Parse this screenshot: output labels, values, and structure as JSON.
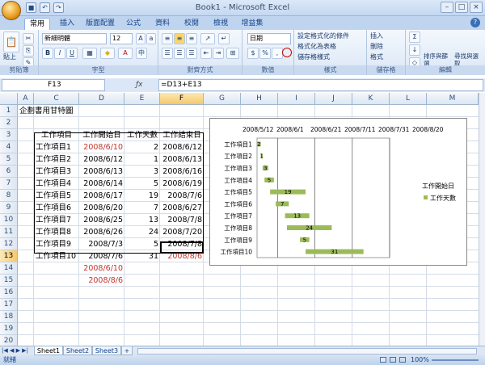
{
  "app": {
    "title": "Book1 - Microsoft Excel",
    "qat": [
      "save",
      "undo",
      "redo"
    ],
    "window_buttons": [
      "–",
      "□",
      "×"
    ]
  },
  "tabs": [
    "常用",
    "插入",
    "版面配置",
    "公式",
    "資料",
    "校閱",
    "檢視",
    "增益集"
  ],
  "active_tab": "常用",
  "ribbon": {
    "paste_label": "貼上",
    "font_name": "新細明體",
    "font_size": "12",
    "number_format": "日期",
    "styles": [
      "設定格式化的條件",
      "格式化為表格",
      "儲存格樣式"
    ],
    "cells": [
      "插入",
      "刪除",
      "格式"
    ],
    "editing": [
      "排序與篩選",
      "尋找與選取"
    ],
    "groups": [
      "剪貼簿",
      "字型",
      "對齊方式",
      "數值",
      "樣式",
      "儲存格",
      "編輯"
    ]
  },
  "formula_bar": {
    "name_box": "F13",
    "formula": "=D13+E13"
  },
  "columns": [
    "A",
    "C",
    "D",
    "E",
    "F",
    "G",
    "H",
    "I",
    "J",
    "K",
    "L",
    "M"
  ],
  "rows": [
    "1",
    "2",
    "3",
    "4",
    "5",
    "6",
    "7",
    "8",
    "9",
    "10",
    "11",
    "12",
    "13",
    "14",
    "15",
    "16",
    "17",
    "18",
    "19",
    "20"
  ],
  "sheet": {
    "title": "企劃書用甘特圖",
    "headers": [
      "工作項目",
      "工作開始日",
      "工作天數",
      "工作結束日"
    ],
    "tasks": [
      {
        "name": "工作項目1",
        "start": "2008/6/10",
        "days": "2",
        "end": "2008/6/12"
      },
      {
        "name": "工作項目2",
        "start": "2008/6/12",
        "days": "1",
        "end": "2008/6/13"
      },
      {
        "name": "工作項目3",
        "start": "2008/6/13",
        "days": "3",
        "end": "2008/6/16"
      },
      {
        "name": "工作項目4",
        "start": "2008/6/14",
        "days": "5",
        "end": "2008/6/19"
      },
      {
        "name": "工作項目5",
        "start": "2008/6/17",
        "days": "19",
        "end": "2008/7/6"
      },
      {
        "name": "工作項目6",
        "start": "2008/6/20",
        "days": "7",
        "end": "2008/6/27"
      },
      {
        "name": "工作項目7",
        "start": "2008/6/25",
        "days": "13",
        "end": "2008/7/8"
      },
      {
        "name": "工作項目8",
        "start": "2008/6/26",
        "days": "24",
        "end": "2008/7/20"
      },
      {
        "name": "工作項目9",
        "start": "2008/7/3",
        "days": "5",
        "end": "2008/7/8"
      },
      {
        "name": "工作項目10",
        "start": "2008/7/6",
        "days": "31",
        "end": "2008/8/6"
      }
    ],
    "min_date": "2008/6/10",
    "max_date": "2008/8/6"
  },
  "chart_data": {
    "type": "bar",
    "orientation": "horizontal-stacked",
    "categories": [
      "工作項目1",
      "工作項目2",
      "工作項目3",
      "工作項目4",
      "工作項目5",
      "工作項目6",
      "工作項目7",
      "工作項目8",
      "工作項目9",
      "工作項目10"
    ],
    "series": [
      {
        "name": "工作開始日",
        "values": [
          "2008/6/10",
          "2008/6/12",
          "2008/6/13",
          "2008/6/14",
          "2008/6/17",
          "2008/6/20",
          "2008/6/25",
          "2008/6/26",
          "2008/7/3",
          "2008/7/6"
        ],
        "color": "none"
      },
      {
        "name": "工作天數",
        "values": [
          2,
          1,
          3,
          5,
          19,
          7,
          13,
          24,
          5,
          31
        ],
        "color": "#9bbb59"
      }
    ],
    "x_ticks": [
      "2008/5/12",
      "2008/6/1",
      "2008/6/21",
      "2008/7/11",
      "2008/7/31",
      "2008/8/20"
    ],
    "x_tick_labels": [
      "2008/5/12",
      "2008/6/1",
      "2008/6/21",
      "2008/7/11",
      "2008/7/31",
      "2008/8/20"
    ],
    "xlim": [
      "2008/6/10",
      "2008/8/20"
    ],
    "data_labels": true,
    "legend": "right",
    "grid": "vertical"
  },
  "sheet_tabs": [
    "Sheet1",
    "Sheet2",
    "Sheet3"
  ],
  "active_sheet": "Sheet1",
  "status": {
    "ready": "就緒",
    "zoom": "100%"
  }
}
